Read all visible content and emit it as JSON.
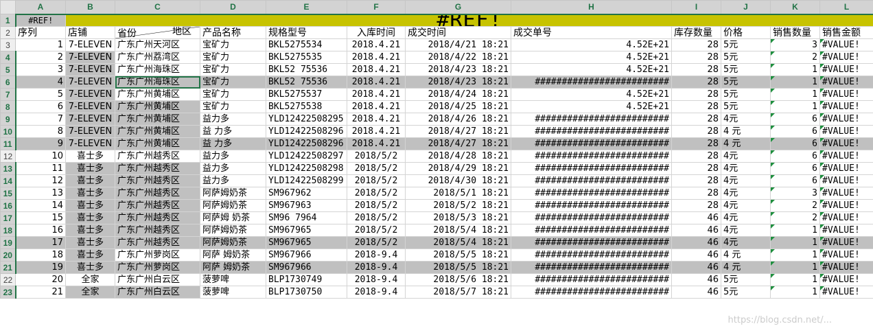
{
  "columns": [
    "A",
    "B",
    "C",
    "D",
    "E",
    "F",
    "G",
    "H",
    "I",
    "J",
    "K",
    "L"
  ],
  "selected_columns": [
    "A",
    "B",
    "C",
    "D",
    "E",
    "F",
    "G",
    "H",
    "I",
    "J",
    "K",
    "L"
  ],
  "title_row": {
    "row_number": "1",
    "ref_small": "#REF!",
    "ref_big": "#REF!"
  },
  "header_row": {
    "row_number": "2",
    "a": "序列",
    "b": "店铺",
    "c_top": "省份",
    "c_bottom": "地区",
    "d": "产品名称",
    "e": "规格型号",
    "f": "入库时间",
    "g": "成交时间",
    "h": "成交单号",
    "i": "库存数量",
    "j": "价格",
    "k": "销售数量",
    "l": "销售金额"
  },
  "rows": [
    {
      "r": "3",
      "a": "1",
      "b": "7-ELEVEN",
      "c": "广东广州天河区",
      "d": "宝矿力",
      "e": "BKL5275534",
      "f": "2018.4.21",
      "g": "2018/4/21 18:21",
      "h": "4.52E+21",
      "i": "28",
      "j": "5元",
      "k": "3",
      "l": "#VALUE!",
      "hl": false,
      "sel": false,
      "bgray": false,
      "cgray": false
    },
    {
      "r": "4",
      "a": "2",
      "b": "7-ELEVEN",
      "c": "广东广州荔湾区",
      "d": "宝矿力",
      "e": "BKL5275535",
      "f": "2018.4.21",
      "g": "2018/4/22 18:21",
      "h": "4.52E+21",
      "i": "28",
      "j": "5元",
      "k": "2",
      "l": "#VALUE!",
      "hl": false,
      "sel": true,
      "bgray": true,
      "cgray": false
    },
    {
      "r": "5",
      "a": "3",
      "b": "7-ELEVEN",
      "c": "广东广州海珠区",
      "d": "宝矿力",
      "e": "BKL52 75536",
      "f": "2018.4.21",
      "g": "2018/4/23 18:21",
      "h": "4.52E+21",
      "i": "28",
      "j": "5元",
      "k": "1",
      "l": "#VALUE!",
      "hl": false,
      "sel": true,
      "bgray": true,
      "cgray": false
    },
    {
      "r": "6",
      "a": "4",
      "b": "7-ELEVEN",
      "c": "广东广州海珠区",
      "d": "宝矿力",
      "e": "BKL52 75536",
      "f": "2018.4.21",
      "g": "2018/4/23 18:21",
      "h": "#########################",
      "i": "28",
      "j": "5元",
      "k": "1",
      "l": "#VALUE!",
      "hl": true,
      "sel": true,
      "bgray": true,
      "cgray": true
    },
    {
      "r": "7",
      "a": "5",
      "b": "7-ELEVEN",
      "c": "广东广州黄埔区",
      "d": "宝矿力",
      "e": "BKL5275537",
      "f": "2018.4.21",
      "g": "2018/4/24 18:21",
      "h": "4.52E+21",
      "i": "28",
      "j": "5元",
      "k": "1",
      "l": "#VALUE!",
      "hl": false,
      "sel": true,
      "bgray": true,
      "cgray": false
    },
    {
      "r": "8",
      "a": "6",
      "b": "7-ELEVEN",
      "c": "广东广州黄埔区",
      "d": "宝矿力",
      "e": "BKL5275538",
      "f": "2018.4.21",
      "g": "2018/4/25 18:21",
      "h": "4.52E+21",
      "i": "28",
      "j": "5元",
      "k": "1",
      "l": "#VALUE!",
      "hl": false,
      "sel": true,
      "bgray": true,
      "cgray": true
    },
    {
      "r": "9",
      "a": "7",
      "b": "7-ELEVEN",
      "c": "广东广州黄埔区",
      "d": " 益力多",
      "e": "YLD12422508295",
      "f": "2018.4.21",
      "g": "2018/4/26 18:21",
      "h": "#########################",
      "i": "28",
      "j": "4元",
      "k": "6",
      "l": "#VALUE!",
      "hl": false,
      "sel": true,
      "bgray": true,
      "cgray": true
    },
    {
      "r": "10",
      "a": "8",
      "b": "7-ELEVEN",
      "c": "广东广州黄埔区",
      "d": "益 力多",
      "e": "YLD12422508296",
      "f": "2018.4.21",
      "g": "2018/4/27 18:21",
      "h": "#########################",
      "i": "28",
      "j": "4 元",
      "k": "6",
      "l": "#VALUE!",
      "hl": false,
      "sel": true,
      "bgray": true,
      "cgray": true
    },
    {
      "r": "11",
      "a": "9",
      "b": "7-ELEVEN",
      "c": "广东广州黄埔区",
      "d": "益 力多",
      "e": "YLD12422508296",
      "f": "2018.4.21",
      "g": "2018/4/27 18:21",
      "h": "#########################",
      "i": "28",
      "j": "4 元",
      "k": "6",
      "l": "#VALUE!",
      "hl": true,
      "sel": true,
      "bgray": true,
      "cgray": true
    },
    {
      "r": "12",
      "a": "10",
      "b": "喜士多",
      "c": "广东广州越秀区",
      "d": "益力多",
      "e": "YLD12422508297",
      "f": "2018/5/2",
      "g": "2018/4/28 18:21",
      "h": "#########################",
      "i": "28",
      "j": "4元",
      "k": "6",
      "l": "#VALUE!",
      "hl": false,
      "sel": false,
      "bgray": false,
      "cgray": false
    },
    {
      "r": "13",
      "a": "11",
      "b": "喜士多",
      "c": "广东广州越秀区",
      "d": "益力多",
      "e": "YLD12422508298",
      "f": "2018/5/2",
      "g": "2018/4/29 18:21",
      "h": "#########################",
      "i": "28",
      "j": "4元",
      "k": "6",
      "l": "#VALUE!",
      "hl": false,
      "sel": true,
      "bgray": true,
      "cgray": true
    },
    {
      "r": "14",
      "a": "12",
      "b": "喜士多",
      "c": "广东广州越秀区",
      "d": "益力多",
      "e": "YLD12422508299",
      "f": "2018/5/2",
      "g": "2018/4/30 18:21",
      "h": "#########################",
      "i": "28",
      "j": "4元",
      "k": "6",
      "l": "#VALUE!",
      "hl": false,
      "sel": true,
      "bgray": true,
      "cgray": true
    },
    {
      "r": "15",
      "a": "13",
      "b": "喜士多",
      "c": "广东广州越秀区",
      "d": "阿萨姆奶茶",
      "e": "SM967962",
      "f": "2018/5/2",
      "g": "2018/5/1 18:21",
      "h": "#########################",
      "i": "28",
      "j": "4元",
      "k": "3",
      "l": "#VALUE!",
      "hl": false,
      "sel": true,
      "bgray": true,
      "cgray": true
    },
    {
      "r": "16",
      "a": "14",
      "b": "喜士多",
      "c": "广东广州越秀区",
      "d": "阿萨姆奶茶",
      "e": "SM967963",
      "f": "2018/5/2",
      "g": "2018/5/2 18:21",
      "h": "#########################",
      "i": "28",
      "j": "4元",
      "k": "2",
      "l": "#VALUE!",
      "hl": false,
      "sel": true,
      "bgray": true,
      "cgray": true
    },
    {
      "r": "17",
      "a": "15",
      "b": "喜士多",
      "c": "广东广州越秀区",
      "d": "阿萨姆 奶茶",
      "e": "SM96 7964",
      "f": "2018/5/2",
      "g": "2018/5/3 18:21",
      "h": "#########################",
      "i": "46",
      "j": "4元",
      "k": "2",
      "l": "#VALUE!",
      "hl": false,
      "sel": true,
      "bgray": true,
      "cgray": true
    },
    {
      "r": "18",
      "a": "16",
      "b": "喜士多",
      "c": "广东广州越秀区",
      "d": "阿萨姆奶茶",
      "e": "SM967965",
      "f": "2018/5/2",
      "g": "2018/5/4 18:21",
      "h": "#########################",
      "i": "46",
      "j": "4元",
      "k": "1",
      "l": "#VALUE!",
      "hl": false,
      "sel": true,
      "bgray": true,
      "cgray": true
    },
    {
      "r": "19",
      "a": "17",
      "b": "喜士多",
      "c": "广东广州越秀区",
      "d": "阿萨姆奶茶",
      "e": "SM967965",
      "f": "2018/5/2",
      "g": "2018/5/4 18:21",
      "h": "#########################",
      "i": "46",
      "j": "4元",
      "k": "1",
      "l": "#VALUE!",
      "hl": true,
      "sel": true,
      "bgray": true,
      "cgray": true
    },
    {
      "r": "20",
      "a": "18",
      "b": "喜士多",
      "c": "广东广州萝岗区",
      "d": "阿萨 姆奶茶",
      "e": "SM967966",
      "f": "2018-9.4",
      "g": "2018/5/5 18:21",
      "h": "#########################",
      "i": "46",
      "j": "4 元",
      "k": "1",
      "l": "#VALUE!",
      "hl": false,
      "sel": true,
      "bgray": true,
      "cgray": false
    },
    {
      "r": "21",
      "a": "19",
      "b": "喜士多",
      "c": "广东广州萝岗区",
      "d": "阿萨 姆奶茶",
      "e": "SM967966",
      "f": "2018-9.4",
      "g": "2018/5/5 18:21",
      "h": "#########################",
      "i": "46",
      "j": "4 元",
      "k": "1",
      "l": "#VALUE!",
      "hl": true,
      "sel": true,
      "bgray": true,
      "cgray": true
    },
    {
      "r": "22",
      "a": "20",
      "b": "全家",
      "c": "广东广州白云区",
      "d": "菠萝啤",
      "e": "BLP1730749",
      "f": "2018-9.4",
      "g": "2018/5/6 18:21",
      "h": "#########################",
      "i": "46",
      "j": "5元",
      "k": "1",
      "l": "#VALUE!",
      "hl": false,
      "sel": false,
      "bgray": false,
      "cgray": false
    },
    {
      "r": "23",
      "a": "21",
      "b": "全家",
      "c": "广东广州白云区",
      "d": "菠萝啤",
      "e": "BLP1730750",
      "f": "2018-9.4",
      "g": "2018/5/7 18:21",
      "h": "#########################",
      "i": "46",
      "j": "5元",
      "k": "1",
      "l": "#VALUE!",
      "hl": false,
      "sel": true,
      "bgray": true,
      "cgray": true
    }
  ],
  "watermark": "https://blog.csdn.net/..."
}
